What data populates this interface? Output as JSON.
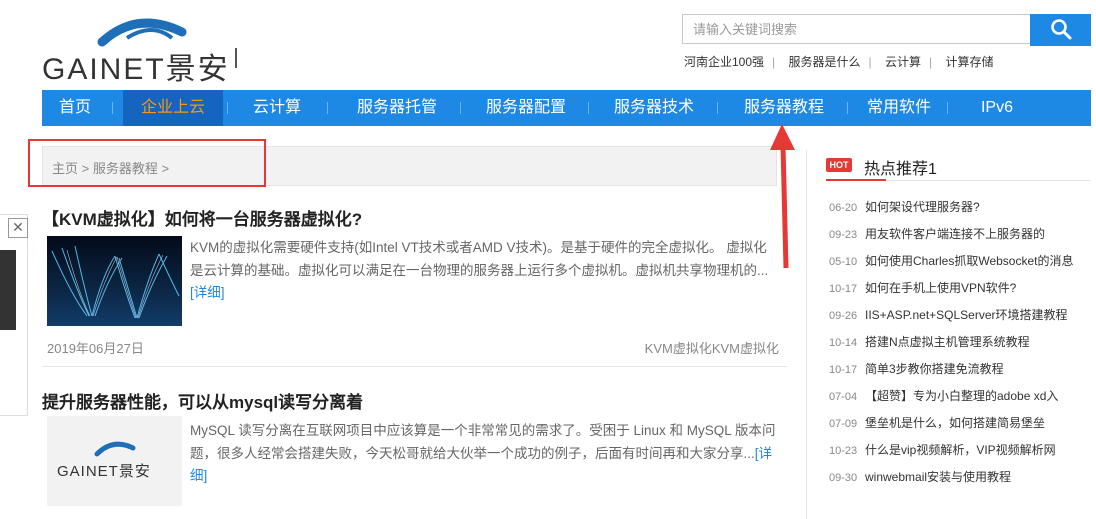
{
  "header": {
    "logo_text": "GAINET景安",
    "search": {
      "placeholder": "请输入关键词搜索"
    },
    "quick_links": [
      "河南企业100强",
      "服务器是什么",
      "云计算",
      "计算存储"
    ]
  },
  "nav": {
    "items": [
      {
        "label": "首页",
        "active": false
      },
      {
        "label": "企业上云",
        "active": true
      },
      {
        "label": "云计算",
        "active": false
      },
      {
        "label": "服务器托管",
        "active": false
      },
      {
        "label": "服务器配置",
        "active": false
      },
      {
        "label": "服务器技术",
        "active": false
      },
      {
        "label": "服务器教程",
        "active": false
      },
      {
        "label": "常用软件",
        "active": false
      },
      {
        "label": "IPv6",
        "active": false
      }
    ]
  },
  "breadcrumb": {
    "home": "主页",
    "sep": ">",
    "current": "服务器教程"
  },
  "side_widget": {
    "close": "✕"
  },
  "articles": [
    {
      "title": "【KVM虚拟化】如何将一台服务器虚拟化?",
      "desc": "KVM的虚拟化需要硬件支持(如Intel VT技术或者AMD V技术)。是基于硬件的完全虚拟化。 虚拟化是云计算的基础。虚拟化可以满足在一台物理的服务器上运行多个虚拟机。虚拟机共享物理机的...",
      "more": "[详细]",
      "date": "2019年06月27日",
      "tags": "KVM虚拟化KVM虚拟化"
    },
    {
      "title": "提升服务器性能，可以从mysql读写分离着",
      "desc": "MySQL 读写分离在互联网项目中应该算是一个非常常见的需求了。受困于 Linux 和 MySQL 版本问题，很多人经常会搭建失败，今天松哥就给大伙举一个成功的例子，后面有时间再和大家分享...",
      "more": "[详细]",
      "thumb_logo": "GAINET景安"
    }
  ],
  "hot": {
    "badge": "HOT",
    "title": "热点推荐1",
    "items": [
      {
        "date": "06-20",
        "title": "如何架设代理服务器?"
      },
      {
        "date": "09-23",
        "title": "用友软件客户端连接不上服务器的"
      },
      {
        "date": "05-10",
        "title": "如何使用Charles抓取Websocket的消息"
      },
      {
        "date": "10-17",
        "title": "如何在手机上使用VPN软件?"
      },
      {
        "date": "09-26",
        "title": "IIS+ASP.net+SQLServer环境搭建教程"
      },
      {
        "date": "10-14",
        "title": "搭建N点虚拟主机管理系统教程"
      },
      {
        "date": "10-17",
        "title": "简单3步教你搭建免流教程"
      },
      {
        "date": "07-04",
        "title": "【超赞】专为小白整理的adobe xd入"
      },
      {
        "date": "07-09",
        "title": "堡垒机是什么，如何搭建简易堡垒"
      },
      {
        "date": "10-23",
        "title": "什么是vip视频解析，VIP视频解析网"
      },
      {
        "date": "09-30",
        "title": "winwebmail安装与使用教程"
      }
    ]
  },
  "colors": {
    "nav_bg": "#1e88e5",
    "nav_active_bg": "#1565c0",
    "nav_active_text": "#ff9800",
    "annotation_red": "#e53935"
  }
}
